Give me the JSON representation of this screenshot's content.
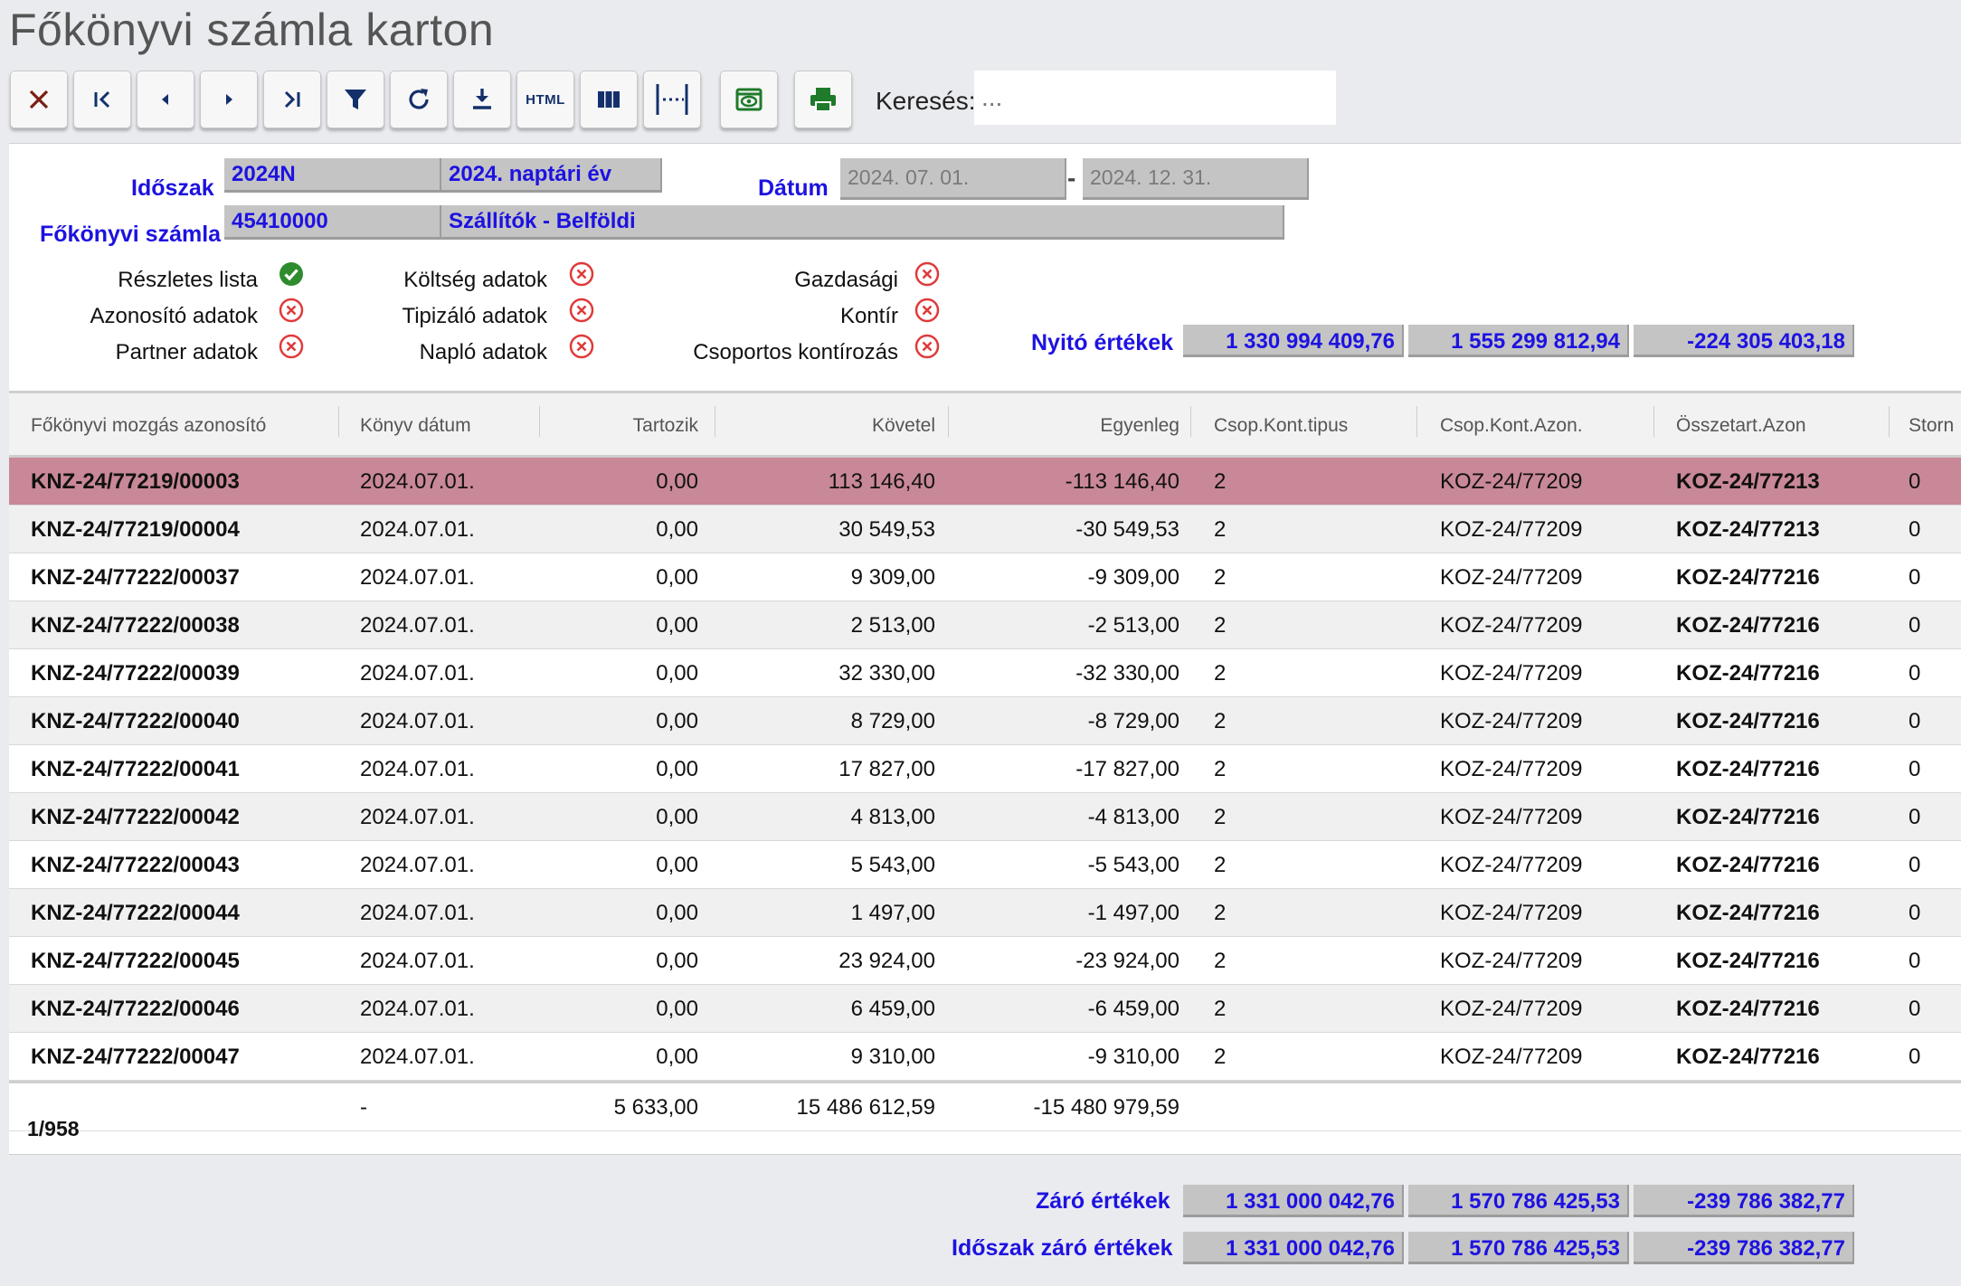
{
  "page_title": "Főkönyvi számla karton",
  "toolbar": {
    "buttons": [
      {
        "name": "close-button",
        "icon": "close-icon"
      },
      {
        "name": "first-button",
        "icon": "first-icon"
      },
      {
        "name": "prev-button",
        "icon": "prev-icon"
      },
      {
        "name": "next-button",
        "icon": "next-icon"
      },
      {
        "name": "last-button",
        "icon": "last-icon"
      },
      {
        "name": "filter-button",
        "icon": "filter-icon"
      },
      {
        "name": "refresh-button",
        "icon": "refresh-icon"
      },
      {
        "name": "download-button",
        "icon": "download-icon"
      },
      {
        "name": "html-export-button",
        "icon": "html-icon",
        "label": "HTML"
      },
      {
        "name": "columns-button",
        "icon": "columns-icon"
      },
      {
        "name": "column-width-button",
        "icon": "column-width-icon"
      },
      {
        "name": "preview-button",
        "icon": "eye-icon"
      },
      {
        "name": "print-button",
        "icon": "printer-icon"
      }
    ],
    "search_label": "Keresés:",
    "search_placeholder": "..."
  },
  "filters": {
    "period_label": "Időszak",
    "period_code": "2024N",
    "period_name": "2024. naptári év",
    "date_label": "Dátum",
    "date_from": "2024. 07. 01.",
    "date_sep": "-",
    "date_to": "2024. 12. 31.",
    "account_label": "Főkönyvi számla",
    "account_code": "45410000",
    "account_name": "Szállítók - Belföldi"
  },
  "options": [
    {
      "label": "Részletes lista",
      "state": "checked"
    },
    {
      "label": "Azonosító adatok",
      "state": "unchecked"
    },
    {
      "label": "Partner adatok",
      "state": "unchecked"
    },
    {
      "label": "Költség adatok",
      "state": "unchecked"
    },
    {
      "label": "Tipizáló adatok",
      "state": "unchecked"
    },
    {
      "label": "Napló adatok",
      "state": "unchecked"
    },
    {
      "label": "Gazdasági",
      "state": "unchecked"
    },
    {
      "label": "Kontír",
      "state": "unchecked"
    },
    {
      "label": "Csoportos kontírozás",
      "state": "unchecked"
    }
  ],
  "opening": {
    "label": "Nyitó értékek",
    "values": [
      "1 330 994 409,76",
      "1 555 299 812,94",
      "-224 305 403,18"
    ]
  },
  "table": {
    "columns": [
      "Főkönyvi mozgás azonosító",
      "Könyv dátum",
      "Tartozik",
      "Követel",
      "Egyenleg",
      "Csop.Kont.tipus",
      "Csop.Kont.Azon.",
      "Összetart.Azon",
      "Storn"
    ],
    "rows": [
      [
        "KNZ-24/77219/00003",
        "2024.07.01.",
        "0,00",
        "113 146,40",
        "-113 146,40",
        "2",
        "KOZ-24/77209",
        "KOZ-24/77213",
        "0"
      ],
      [
        "KNZ-24/77219/00004",
        "2024.07.01.",
        "0,00",
        "30 549,53",
        "-30 549,53",
        "2",
        "KOZ-24/77209",
        "KOZ-24/77213",
        "0"
      ],
      [
        "KNZ-24/77222/00037",
        "2024.07.01.",
        "0,00",
        "9 309,00",
        "-9 309,00",
        "2",
        "KOZ-24/77209",
        "KOZ-24/77216",
        "0"
      ],
      [
        "KNZ-24/77222/00038",
        "2024.07.01.",
        "0,00",
        "2 513,00",
        "-2 513,00",
        "2",
        "KOZ-24/77209",
        "KOZ-24/77216",
        "0"
      ],
      [
        "KNZ-24/77222/00039",
        "2024.07.01.",
        "0,00",
        "32 330,00",
        "-32 330,00",
        "2",
        "KOZ-24/77209",
        "KOZ-24/77216",
        "0"
      ],
      [
        "KNZ-24/77222/00040",
        "2024.07.01.",
        "0,00",
        "8 729,00",
        "-8 729,00",
        "2",
        "KOZ-24/77209",
        "KOZ-24/77216",
        "0"
      ],
      [
        "KNZ-24/77222/00041",
        "2024.07.01.",
        "0,00",
        "17 827,00",
        "-17 827,00",
        "2",
        "KOZ-24/77209",
        "KOZ-24/77216",
        "0"
      ],
      [
        "KNZ-24/77222/00042",
        "2024.07.01.",
        "0,00",
        "4 813,00",
        "-4 813,00",
        "2",
        "KOZ-24/77209",
        "KOZ-24/77216",
        "0"
      ],
      [
        "KNZ-24/77222/00043",
        "2024.07.01.",
        "0,00",
        "5 543,00",
        "-5 543,00",
        "2",
        "KOZ-24/77209",
        "KOZ-24/77216",
        "0"
      ],
      [
        "KNZ-24/77222/00044",
        "2024.07.01.",
        "0,00",
        "1 497,00",
        "-1 497,00",
        "2",
        "KOZ-24/77209",
        "KOZ-24/77216",
        "0"
      ],
      [
        "KNZ-24/77222/00045",
        "2024.07.01.",
        "0,00",
        "23 924,00",
        "-23 924,00",
        "2",
        "KOZ-24/77209",
        "KOZ-24/77216",
        "0"
      ],
      [
        "KNZ-24/77222/00046",
        "2024.07.01.",
        "0,00",
        "6 459,00",
        "-6 459,00",
        "2",
        "KOZ-24/77209",
        "KOZ-24/77216",
        "0"
      ],
      [
        "KNZ-24/77222/00047",
        "2024.07.01.",
        "0,00",
        "9 310,00",
        "-9 310,00",
        "2",
        "KOZ-24/77209",
        "KOZ-24/77216",
        "0"
      ]
    ],
    "totals": {
      "date": "-",
      "debit": "5 633,00",
      "credit": "15 486 612,59",
      "balance": "-15 480 979,59"
    },
    "pager": "1/958"
  },
  "closing": {
    "label": "Záró értékek",
    "values": [
      "1 331 000 042,76",
      "1 570 786 425,53",
      "-239 786 382,77"
    ]
  },
  "period_closing": {
    "label": "Időszak záró értékek",
    "values": [
      "1 331 000 042,76",
      "1 570 786 425,53",
      "-239 786 382,77"
    ]
  },
  "colors": {
    "accent_blue": "#1d12e0",
    "selected_row": "#c98897",
    "error_red": "#e03a3a",
    "ok_green": "#2e8b2e"
  }
}
